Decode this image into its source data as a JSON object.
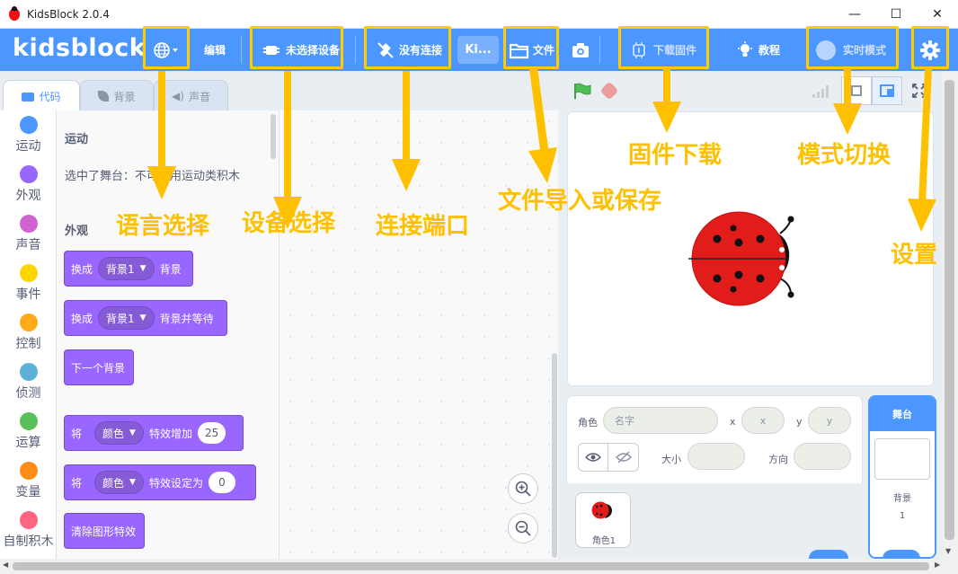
{
  "window": {
    "title": "KidsBlock 2.0.4",
    "minimize_glyph": "—",
    "maximize_glyph": "☐",
    "close_glyph": "✕"
  },
  "menubar": {
    "logo": "kidsblock",
    "language_icon": "globe-icon",
    "edit_label": "编辑",
    "device_label": "未选择设备",
    "connection_label": "没有连接",
    "project_label": "Ki...",
    "file_label": "文件",
    "firmware_label": "下载固件",
    "tutorial_label": "教程",
    "mode_label": "实时模式",
    "settings_icon": "gear-icon",
    "colors": {
      "bar": "#4c97ff",
      "highlight": "#ffcc00"
    }
  },
  "tabs": [
    {
      "label": "代码",
      "icon": "code-icon",
      "active": true
    },
    {
      "label": "背景",
      "icon": "brush-icon",
      "active": false
    },
    {
      "label": "声音",
      "icon": "speaker-icon",
      "active": false
    }
  ],
  "categories": [
    {
      "label": "运动",
      "color": "#4c97ff"
    },
    {
      "label": "外观",
      "color": "#9966ff"
    },
    {
      "label": "声音",
      "color": "#cf63cf"
    },
    {
      "label": "事件",
      "color": "#ffd500"
    },
    {
      "label": "控制",
      "color": "#ffab19"
    },
    {
      "label": "侦测",
      "color": "#5cb1d6"
    },
    {
      "label": "运算",
      "color": "#59c059"
    },
    {
      "label": "变量",
      "color": "#ff8c1a"
    },
    {
      "label": "自制积木",
      "color": "#ff6680"
    }
  ],
  "palette": {
    "motion_title": "运动",
    "motion_note": "选中了舞台：不可使用运动类积木",
    "looks_title": "外观",
    "blocks": [
      {
        "prefix": "换成",
        "dropdown": "背景1",
        "suffix": "背景"
      },
      {
        "prefix": "换成",
        "dropdown": "背景1",
        "suffix": "背景并等待"
      },
      {
        "prefix": "下一个背景"
      },
      {
        "prefix": "将",
        "dropdown": "颜色",
        "suffix": "特效增加",
        "value": "25"
      },
      {
        "prefix": "将",
        "dropdown": "颜色",
        "suffix": "特效设定为",
        "value": "0"
      },
      {
        "prefix": "清除图形特效"
      }
    ]
  },
  "sprite_info": {
    "sprite_label": "角色",
    "name_placeholder": "名字",
    "x_label": "x",
    "x_placeholder": "x",
    "y_label": "y",
    "y_placeholder": "y",
    "size_label": "大小",
    "direction_label": "方向",
    "sprite_name": "角色1"
  },
  "stage_pane": {
    "header": "舞台",
    "backdrops_label": "背景",
    "backdrops_count": "1"
  },
  "annotations": {
    "language": "语言选择",
    "device": "设备选择",
    "connect": "连接端口",
    "file": "文件导入或保存",
    "firmware": "固件下载",
    "mode": "模式切换",
    "settings": "设置"
  }
}
